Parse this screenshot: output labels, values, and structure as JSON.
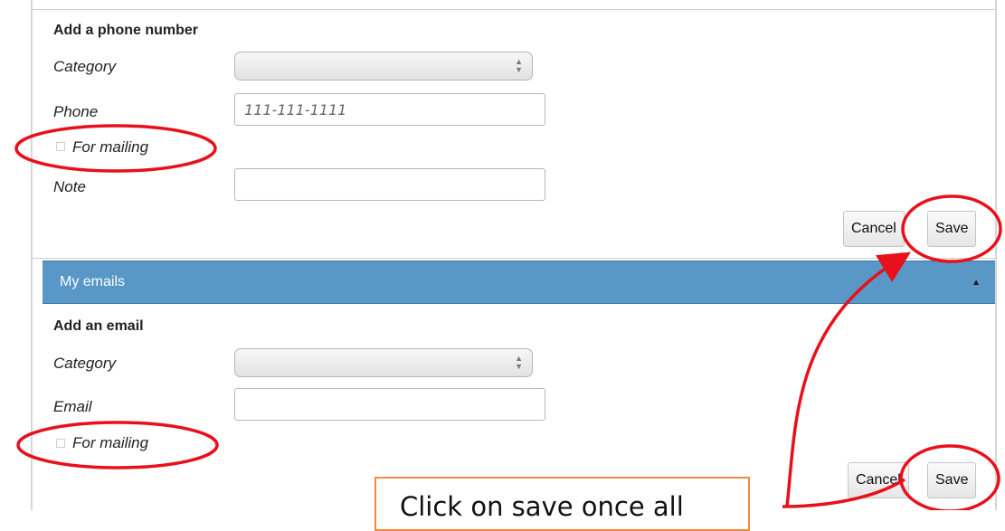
{
  "phone_section": {
    "title": "Add a phone number",
    "category_label": "Category",
    "phone_label": "Phone",
    "phone_placeholder": "111-111-1111",
    "mailing_label": "For mailing",
    "note_label": "Note",
    "cancel_label": "Cancel",
    "save_label": "Save"
  },
  "emails_bar": {
    "title": "My emails",
    "toggle_icon": "triangle-up-icon"
  },
  "email_section": {
    "title": "Add an email",
    "category_label": "Category",
    "email_label": "Email",
    "mailing_label": "For mailing",
    "cancel_label": "Cancel",
    "save_label": "Save"
  },
  "annotation": {
    "callout_text": "Click on save once all",
    "highlight_color": "#e8101b",
    "callout_border_color": "#f08a3c"
  }
}
